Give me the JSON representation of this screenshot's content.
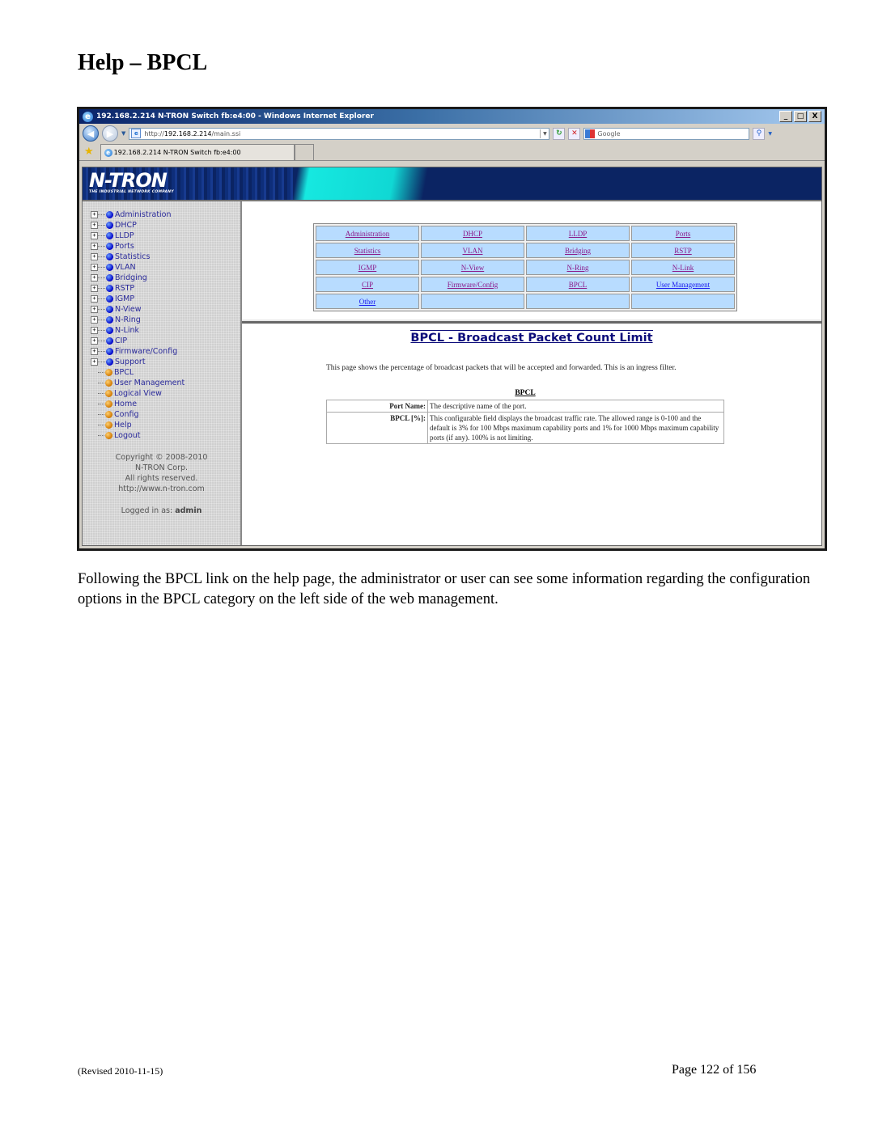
{
  "document": {
    "heading": "Help – BPCL",
    "caption": "Following the BPCL link on the help page, the administrator or user can see some information regarding the configuration options in the BPCL category on the left side of the web management.",
    "footer_revised": "(Revised 2010-11-15)",
    "footer_page": "Page 122 of 156"
  },
  "browser": {
    "window_title": "192.168.2.214 N-TRON Switch fb:e4:00 - Windows Internet Explorer",
    "url_prefix": "http://",
    "url_host": "192.168.2.214",
    "url_path": "/main.ssi",
    "search_placeholder": "Google",
    "tab_label": "192.168.2.214 N-TRON Switch fb:e4:00",
    "buttons": {
      "minimize": "_",
      "maximize": "□",
      "close": "X",
      "back": "◀",
      "forward": "▶",
      "refresh": "↻",
      "stop": "✕",
      "search": "⚲"
    }
  },
  "banner": {
    "logo": "N-TRON",
    "tagline": "THE INDUSTRIAL NETWORK COMPANY"
  },
  "sidebar": {
    "folders": [
      "Administration",
      "DHCP",
      "LLDP",
      "Ports",
      "Statistics",
      "VLAN",
      "Bridging",
      "RSTP",
      "IGMP",
      "N-View",
      "N-Ring",
      "N-Link",
      "CIP",
      "Firmware/Config",
      "Support"
    ],
    "leaves": [
      "BPCL",
      "User Management",
      "Logical View",
      "Home",
      "Config",
      "Help",
      "Logout"
    ],
    "copyright": "Copyright © 2008-2010",
    "company": "N-TRON Corp.",
    "rights": "All rights reserved.",
    "website": "http://www.n-tron.com",
    "logged_in_label": "Logged in as:",
    "logged_in_user": "admin"
  },
  "help_nav": {
    "rows": [
      [
        "Administration",
        "DHCP",
        "LLDP",
        "Ports"
      ],
      [
        "Statistics",
        "VLAN",
        "Bridging",
        "RSTP"
      ],
      [
        "IGMP",
        "N-View",
        "N-Ring",
        "N-Link"
      ],
      [
        "CIP",
        "Firmware/Config",
        "BPCL",
        "User Management"
      ],
      [
        "Other",
        "",
        "",
        ""
      ]
    ]
  },
  "help_page": {
    "title": "BPCL - Broadcast Packet Count Limit",
    "description": "This page shows the percentage of broadcast packets that will be accepted and forwarded. This is an ingress filter.",
    "table_caption": "BPCL",
    "fields": [
      {
        "name": "Port Name:",
        "desc": "The descriptive name of the port."
      },
      {
        "name": "BPCL [%]:",
        "desc": "This configurable field displays the broadcast traffic rate. The allowed range is 0-100 and the default is 3% for 100 Mbps maximum capability ports and 1% for 1000 Mbps maximum capability ports (if any). 100% is not limiting."
      }
    ]
  }
}
